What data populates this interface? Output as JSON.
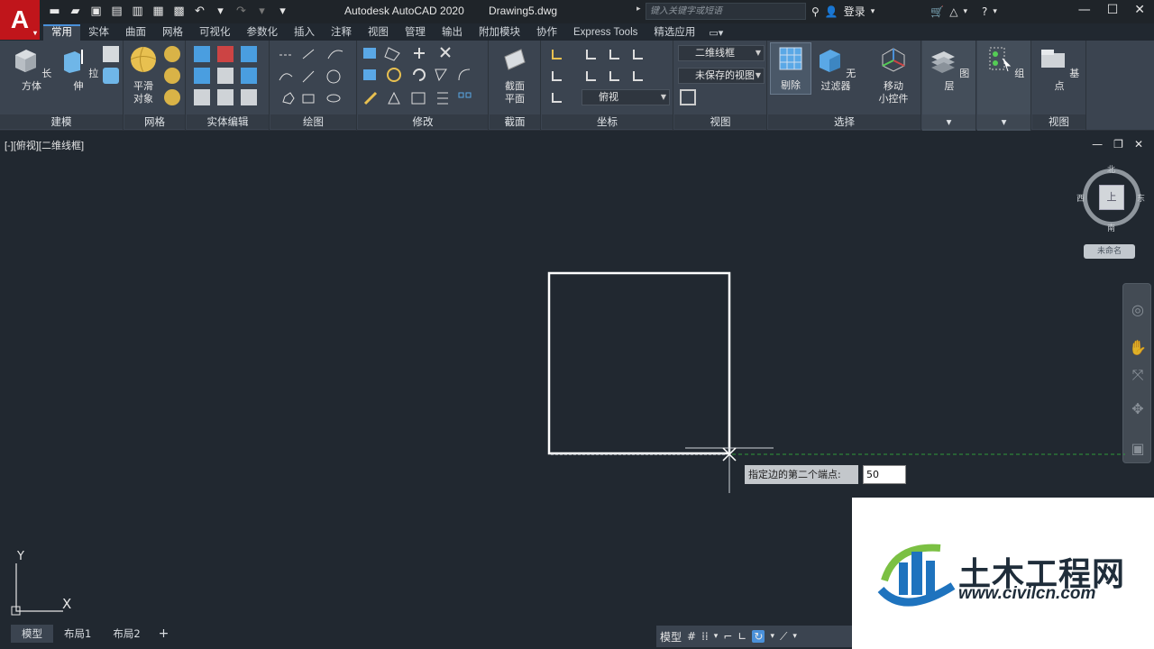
{
  "titlebar": {
    "app_letter": "A",
    "app_name": "Autodesk AutoCAD 2020",
    "file_name": "Drawing5.dwg",
    "search_placeholder": "键入关键字或短语",
    "login": "登录"
  },
  "tabs": [
    "常用",
    "实体",
    "曲面",
    "网格",
    "可视化",
    "参数化",
    "插入",
    "注释",
    "视图",
    "管理",
    "输出",
    "附加模块",
    "协作",
    "Express Tools",
    "精选应用"
  ],
  "ribbon": {
    "panels": {
      "modeling": "建模",
      "mesh": "网格",
      "solid_edit": "实体编辑",
      "draw": "绘图",
      "modify": "修改",
      "section": "截面",
      "coordinates": "坐标",
      "view": "视图",
      "selection": "选择",
      "layers": "图层",
      "groups": "组",
      "view2": "视图"
    },
    "buttons": {
      "box": "长方体",
      "extrude": "拉伸",
      "smooth_line1": "平滑",
      "smooth_line2": "对象",
      "section_line1": "截面",
      "section_line2": "平面",
      "culling": "剔除",
      "no_filter": "无过滤器",
      "move_line1": "移动",
      "move_line2": "小控件",
      "layers": "图层",
      "group": "组",
      "base": "基点"
    },
    "combos": {
      "visual_style": "二维线框",
      "saved_view": "未保存的视图",
      "view_top": "俯视"
    }
  },
  "viewport": {
    "label": "[-][俯视][二维线框]",
    "viewcube": {
      "face": "上",
      "north": "北",
      "south": "南",
      "east": "东",
      "west": "西"
    },
    "ucs_name": "未命名"
  },
  "command": {
    "prompt": "指定边的第二个端点:",
    "input_value": "50"
  },
  "ucs": {
    "y": "Y",
    "x": "X"
  },
  "layout_tabs": [
    "模型",
    "布局1",
    "布局2"
  ],
  "statusbar": {
    "model": "模型"
  },
  "watermark": {
    "title": "土木工程网",
    "url": "www.civilcn.com"
  },
  "colors": {
    "background": "#212830",
    "ribbon": "#3b4450",
    "accent": "#4a90d9",
    "app_red": "#c0151b"
  }
}
